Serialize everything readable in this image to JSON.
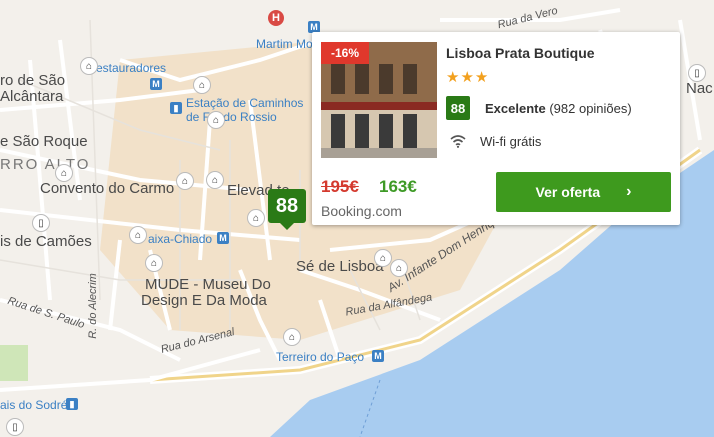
{
  "map": {
    "labels": {
      "martim_moniz": "Martim Mo",
      "rua_da_verona": "Rua da Vero",
      "restauradores": "estauradores",
      "miro_sao": "ro de São",
      "alcantara": "Alcântara",
      "estacao_1": "Estação de Caminhos",
      "estacao_2": "de F   o do Rossio",
      "sao_roque": "e São Roque",
      "bairro_alto": "RRO ALTO",
      "convento": "Convento do Carmo",
      "elevador": "Elevad    te",
      "camoes": "is de Camões",
      "baixa_chiado": "aixa-Chiado",
      "mude_1": "MUDE - Museu Do",
      "mude_2": "Design E Da Moda",
      "se_lisboa": "Sé de Lisboa",
      "rua_alfandega": "Rua da Alfândega",
      "av_infante": "Av. Infante Dom Henrique",
      "rua_sao_paulo": "Rua de S. Paulo",
      "r_alecrim": "R. do Alecrim",
      "rua_arsenal": "Rua do Arsenal",
      "terreiro": "Terreiro do Paço",
      "cais_sodre": "ais do Sodré",
      "nac": "Nac"
    },
    "colors": {
      "water": "#a8ccf0",
      "land": "#f3f0eb",
      "streets": "#ffffff",
      "old_town": "#f1ddc0"
    }
  },
  "marker": {
    "score": "88"
  },
  "card": {
    "discount": "-16%",
    "hotel_name": "Lisboa Prata Boutique",
    "stars": "★★★",
    "score": "88",
    "rating_word": "Excelente",
    "reviews": "(982 opiniões)",
    "amenity": "Wi-fi grátis",
    "old_price": "195€",
    "new_price": "163€",
    "provider": "Booking.com",
    "cta": "Ver oferta",
    "cta_chevron": "›"
  }
}
